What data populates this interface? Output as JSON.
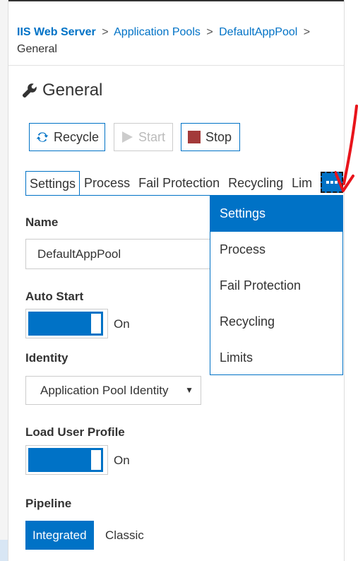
{
  "breadcrumb": {
    "root": "IIS Web Server",
    "sep": ">",
    "items": [
      "Application Pools",
      "DefaultAppPool"
    ],
    "current": "General"
  },
  "page": {
    "title": "General"
  },
  "toolbar": {
    "recycle": "Recycle",
    "start": "Start",
    "stop": "Stop"
  },
  "tabs": [
    "Settings",
    "Process",
    "Fail Protection",
    "Recycling",
    "Limits"
  ],
  "tabs_visible": [
    "Settings",
    "Process",
    "Fail Protection",
    "Recycling",
    "Lim"
  ],
  "dropdown": {
    "items": [
      "Settings",
      "Process",
      "Fail Protection",
      "Recycling",
      "Limits"
    ],
    "selected": "Settings"
  },
  "form": {
    "name_label": "Name",
    "name_value": "DefaultAppPool",
    "autostart_label": "Auto Start",
    "autostart_state": "On",
    "identity_label": "Identity",
    "identity_value": "Application Pool Identity",
    "loadprofile_label": "Load User Profile",
    "loadprofile_state": "On",
    "pipeline_label": "Pipeline",
    "pipeline_options": [
      "Integrated",
      "Classic"
    ],
    "pipeline_selected": "Integrated"
  },
  "colors": {
    "accent": "#0072c6",
    "stop": "#a33a3a",
    "annotation": "#e8141b"
  }
}
